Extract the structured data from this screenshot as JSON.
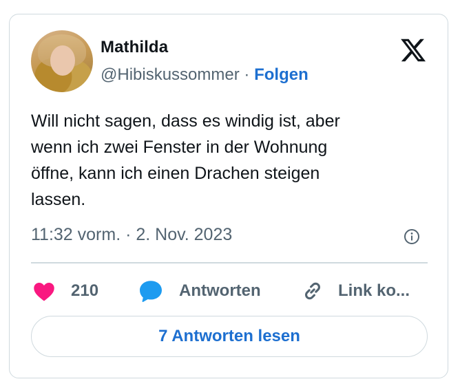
{
  "author": {
    "name": "Mathilda",
    "handle": "@Hibiskussommer",
    "separator": "·",
    "follow_label": "Folgen"
  },
  "tweet": {
    "lines": [
      "Will nicht sagen, dass es windig ist, aber",
      "wenn ich zwei Fenster in der Wohnung",
      "öffne, kann ich einen Drachen steigen",
      "lassen."
    ],
    "timestamp": "11:32 vorm. · 2. Nov. 2023"
  },
  "actions": {
    "like_count": "210",
    "reply_label": "Antworten",
    "link_label": "Link ko..."
  },
  "read_replies_label": "7 Antworten lesen",
  "icons": {
    "logo": "x-logo-icon",
    "info": "info-icon",
    "like": "heart-icon",
    "reply": "speech-bubble-icon",
    "link": "link-icon"
  },
  "colors": {
    "text": "#0f1419",
    "secondary": "#536471",
    "accent": "#1d6fd0",
    "heart": "#f91880",
    "reply_bubble": "#1d9bf0",
    "border": "#cfd9de"
  }
}
